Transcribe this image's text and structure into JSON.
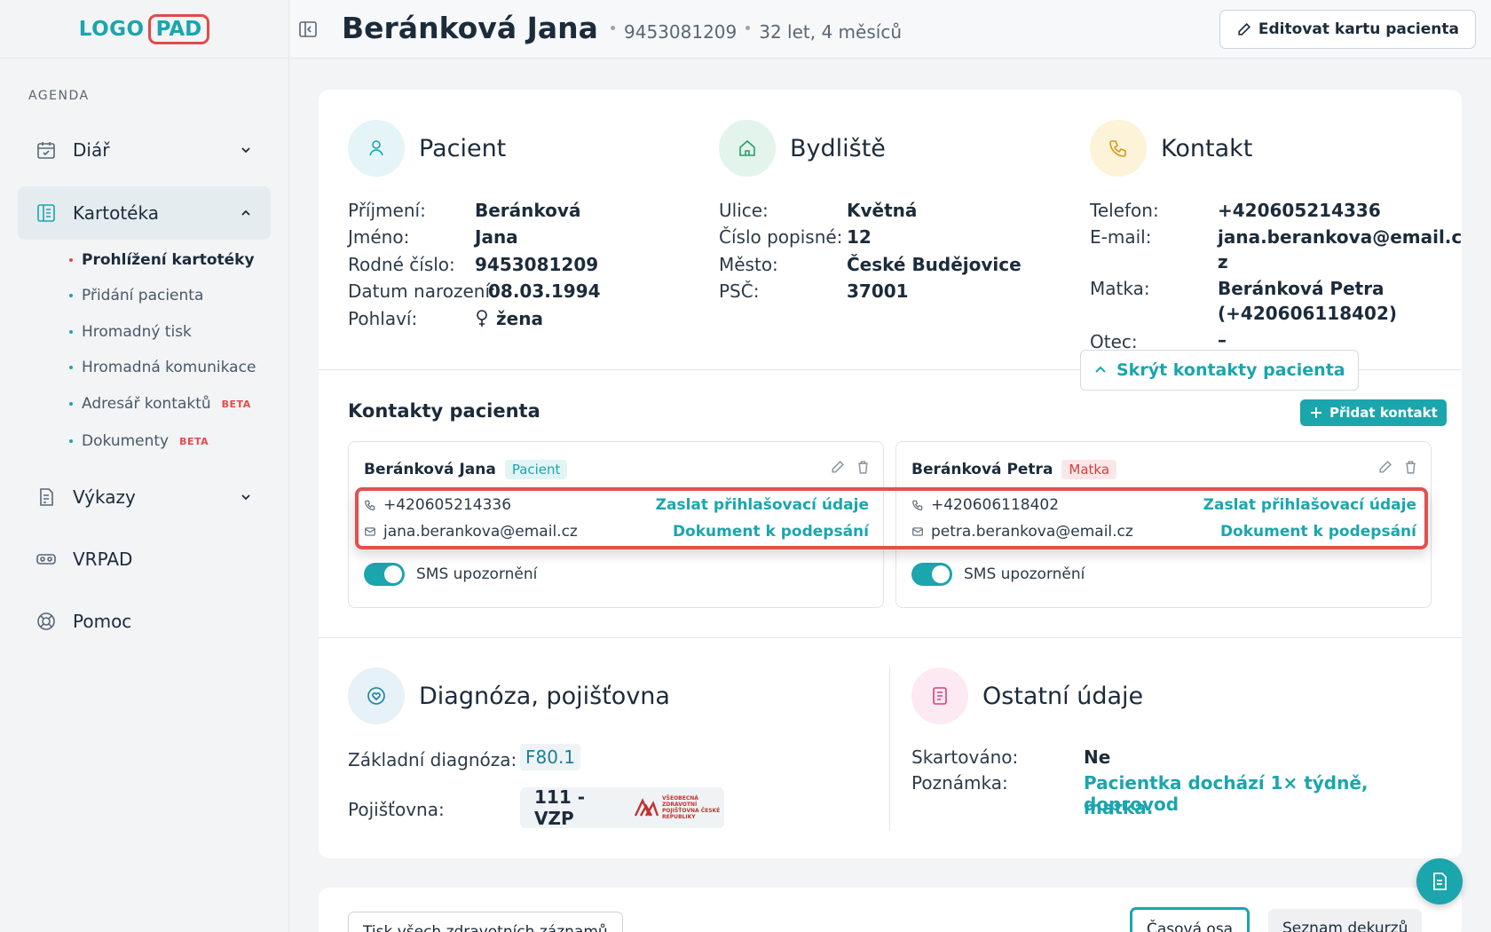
{
  "logo": {
    "left": "LOGO",
    "right": "PAD"
  },
  "sidebar": {
    "section_label": "AGENDA",
    "items": [
      {
        "label": "Diář"
      },
      {
        "label": "Kartotéka"
      },
      {
        "label": "Výkazy"
      },
      {
        "label": "VRPAD"
      },
      {
        "label": "Pomoc"
      }
    ],
    "subitems": [
      {
        "label": "Prohlížení kartotéky"
      },
      {
        "label": "Přidání pacienta"
      },
      {
        "label": "Hromadný tisk"
      },
      {
        "label": "Hromadná komunikace"
      },
      {
        "label": "Adresář kontaktů",
        "badge": "BETA"
      },
      {
        "label": "Dokumenty",
        "badge": "BETA"
      }
    ]
  },
  "header": {
    "name": "Beránková Jana",
    "id": "9453081209",
    "age": "32 let, 4 měsíců",
    "edit_label": "Editovat kartu pacienta"
  },
  "patient": {
    "title": "Pacient",
    "rows": [
      {
        "label": "Příjmení:",
        "value": "Beránková"
      },
      {
        "label": "Jméno:",
        "value": "Jana"
      },
      {
        "label": "Rodné číslo:",
        "value": "9453081209"
      },
      {
        "label": "Datum narození:",
        "value": "08.03.1994"
      },
      {
        "label": "Pohlaví:",
        "value": "žena"
      }
    ]
  },
  "residence": {
    "title": "Bydliště",
    "rows": [
      {
        "label": "Ulice:",
        "value": "Květná"
      },
      {
        "label": "Číslo popisné:",
        "value": "12"
      },
      {
        "label": "Město:",
        "value": "České Budějovice"
      },
      {
        "label": "PSČ:",
        "value": "37001"
      }
    ]
  },
  "contact": {
    "title": "Kontakt",
    "phone_label": "Telefon:",
    "phone": "+420605214336",
    "email_label": "E-mail:",
    "email_line1": "jana.berankova@email.c",
    "email_line2": "z",
    "mother_label": "Matka:",
    "mother_line1": "Beránková Petra",
    "mother_line2": "(+420606118402)",
    "father_label": "Otec:",
    "father": "–",
    "hide_label": "Skrýt kontakty pacienta"
  },
  "contacts": {
    "title": "Kontakty pacienta",
    "add_label": "Přidat kontakt",
    "cards": [
      {
        "name": "Beránková Jana",
        "badge": "Pacient",
        "phone": "+420605214336",
        "email": "jana.berankova@email.cz",
        "link1": "Zaslat přihlašovací údaje",
        "link2": "Dokument k podepsání",
        "sms": "SMS upozornění",
        "sms_on": true
      },
      {
        "name": "Beránková Petra",
        "badge": "Matka",
        "phone": "+420606118402",
        "email": "petra.berankova@email.cz",
        "link1": "Zaslat přihlašovací údaje",
        "link2": "Dokument k podepsání",
        "sms": "SMS upozornění",
        "sms_on": true
      }
    ]
  },
  "diagnosis": {
    "title": "Diagnóza, pojišťovna",
    "diag_label": "Základní diagnóza:",
    "diag": "F80.1",
    "ins_label": "Pojišťovna:",
    "ins": "111 - VZP",
    "ins_logo_text": "VŠEOBECNÁ ZDRAVOTNÍ POJIŠŤOVNA ČESKÉ REPUBLIKY"
  },
  "other": {
    "title": "Ostatní údaje",
    "shred_label": "Skartováno:",
    "shred": "Ne",
    "note_label": "Poznámka:",
    "note_line1": "Pacientka dochází 1× týdně, doprovod",
    "note_line2": "matka."
  },
  "bottom": {
    "print_label": "Tisk všech zdravotních záznamů",
    "timeline_label": "Časová osa",
    "list_label": "Seznam dekurzů"
  },
  "colors": {
    "accent": "#1ba5ad",
    "alert": "#e34a4a",
    "text": "#1c2b3a"
  }
}
